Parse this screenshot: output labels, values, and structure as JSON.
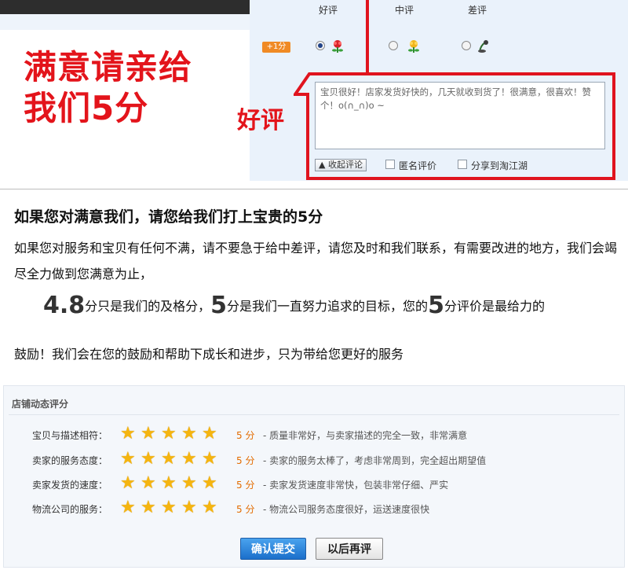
{
  "banner": {
    "slogan_line1": "满意请亲给",
    "slogan_line2": "我们5分",
    "haoping_tag": "好评"
  },
  "rating_panel": {
    "col_good": "好评",
    "col_mid": "中评",
    "col_bad": "差评",
    "plus_badge": "+1分",
    "selected": "good",
    "comment": "宝贝很好！店家发货好快的，几天就收到货了！很满意，很喜欢！赞个！o(∩_∩)o ~",
    "collapse_label": "收起评论",
    "anonymous_label": "匿名评价",
    "share_label": "分享到淘江湖"
  },
  "middle": {
    "headline": "如果您对满意我们，请您给我们打上宝贵的5分",
    "paragraph": "如果您对服务和宝贝有任何不满，请不要急于给中差评，请您及时和我们联系，有需要改进的地方，我们会竭尽全力做到您满意为止，",
    "num1": "4.8",
    "text1": "分只是我们的及格分，",
    "num2": "5",
    "text2": "分是我们一直努力追求的目标，您的",
    "num3": "5",
    "text3": "分评价是最给力的",
    "tail": "鼓励！我们会在您的鼓励和帮助下成长和进步，只为带给您更好的服务"
  },
  "ratings": {
    "title": "店铺动态评分",
    "rows": [
      {
        "label": "宝贝与描述相符：",
        "stars": 5,
        "score": "5 分",
        "desc": "- 质量非常好，与卖家描述的完全一致，非常满意"
      },
      {
        "label": "卖家的服务态度：",
        "stars": 5,
        "score": "5 分",
        "desc": "- 卖家的服务太棒了，考虑非常周到，完全超出期望值"
      },
      {
        "label": "卖家发货的速度：",
        "stars": 5,
        "score": "5 分",
        "desc": "- 卖家发货速度非常快，包装非常仔细、严实"
      },
      {
        "label": "物流公司的服务：",
        "stars": 5,
        "score": "5 分",
        "desc": "- 物流公司服务态度很好，运送速度很快"
      }
    ]
  },
  "buttons": {
    "confirm": "确认提交",
    "later": "以后再评"
  },
  "colors": {
    "accent_red": "#e3141b",
    "star": "#f5b50f",
    "score": "#e36c00",
    "confirm_blue": "#1b6fcb"
  }
}
